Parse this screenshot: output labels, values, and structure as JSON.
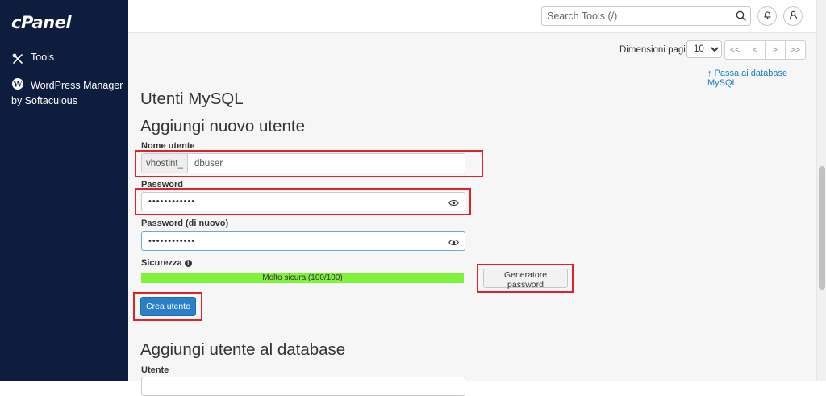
{
  "sidebar": {
    "logo": "cPanel",
    "tools_label": "Tools",
    "wp_label": "WordPress Manager",
    "wp_sub_label": "by Softaculous"
  },
  "header": {
    "search_placeholder": "Search Tools (/)"
  },
  "pagination": {
    "page_size_label": "Dimensioni pagina",
    "page_size_value": "10",
    "first": "<<",
    "prev": "<",
    "next": ">",
    "last": ">>"
  },
  "goto_db_link": "↑ Passa ai database MySQL",
  "page_title": "Utenti MySQL",
  "add_user": {
    "heading": "Aggiungi nuovo utente",
    "username_label": "Nome utente",
    "username_prefix": "vhostint_",
    "username_value": "dbuser",
    "password_label": "Password",
    "password_value": "••••••••••••",
    "password2_label": "Password (di nuovo)",
    "password2_value": "••••••••••••",
    "strength_label": "Sicurezza",
    "strength_text": "Molto sicura (100/100)",
    "strength_level_percent": 100,
    "generator_button": "Generatore password",
    "create_button": "Crea utente"
  },
  "add_to_db": {
    "heading": "Aggiungi utente al database",
    "user_label": "Utente"
  },
  "colors": {
    "sidebar_bg": "#0e1c3d",
    "primary_button": "#2a7fc8",
    "strength_bar": "#7ff23a",
    "highlight": "#e0212a",
    "link": "#1a7cc2"
  }
}
